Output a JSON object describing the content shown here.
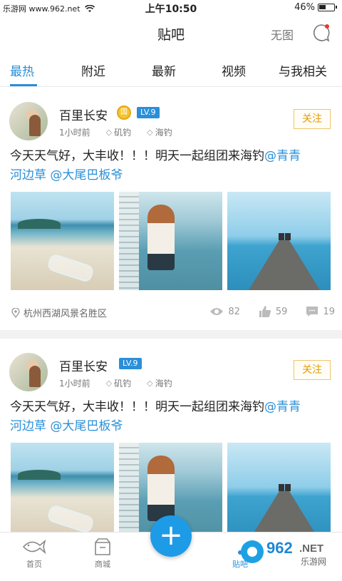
{
  "status": {
    "site": "乐游网 www.962.net",
    "time": "上午10:50",
    "battery": "46%"
  },
  "nav": {
    "title": "贴吧",
    "action": "无图"
  },
  "tabs": [
    {
      "label": "最热",
      "active": true
    },
    {
      "label": "附近",
      "active": false
    },
    {
      "label": "最新",
      "active": false
    },
    {
      "label": "视频",
      "active": false
    },
    {
      "label": "与我相关",
      "active": false
    }
  ],
  "posts": [
    {
      "author": "百里长安",
      "medal": "国",
      "level": "LV.9",
      "time": "1小时前",
      "tags": [
        "矶钓",
        "海钓"
      ],
      "follow": "关注",
      "text_line1_plain": "今天天气好，大丰收！！！明天一起组团来海钓",
      "text_line1_mention": "@青青",
      "text_line2_mention": "河边草 @大尾巴板爷",
      "location": "杭州西湖风景名胜区",
      "views": "82",
      "likes": "59",
      "comments": "19"
    },
    {
      "author": "百里长安",
      "level": "LV.9",
      "time": "1小时前",
      "tags": [
        "矶钓",
        "海钓"
      ],
      "follow": "关注",
      "text_line1_plain": "今天天气好，大丰收！！！明天一起组团来海钓",
      "text_line1_mention": "@青青",
      "text_line2_mention": "河边草 @大尾巴板爷"
    }
  ],
  "tabbar": {
    "home": "首页",
    "mall": "商城",
    "tieba": "贴吧",
    "watermark": "962.NET 乐游网"
  },
  "colors": {
    "accent": "#2a8fd8",
    "follow": "#e39a0b",
    "fab": "#1e9be6"
  }
}
